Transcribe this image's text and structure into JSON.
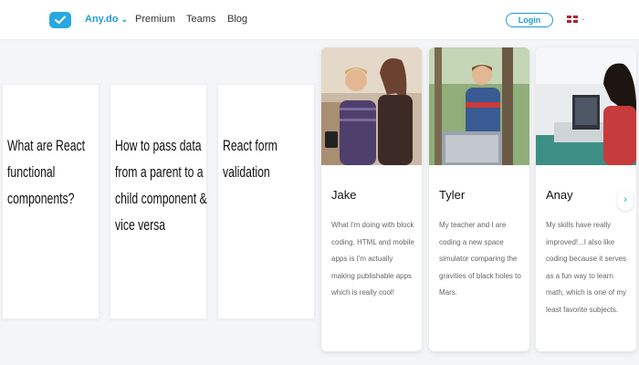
{
  "header": {
    "brand": "Any.do",
    "nav": [
      "Premium",
      "Teams",
      "Blog"
    ],
    "login_label": "Login",
    "icons": {
      "logo": "check-icon",
      "brand_chevron": "chevron-down-icon",
      "language_flag": "uk-flag-icon"
    }
  },
  "blog_posts": [
    {
      "title": "What are React functional components?"
    },
    {
      "title": "How to pass data from a parent to a child component & vice versa"
    },
    {
      "title": "React form validation"
    }
  ],
  "testimonials": [
    {
      "name": "Jake",
      "text": "What I'm doing with block coding, HTML and mobile apps is I'm actually making publishable apps which is really cool!"
    },
    {
      "name": "Tyler",
      "text": "My teacher and I are coding a new space simulator comparing the gravities of black holes to Mars."
    },
    {
      "name": "Anay",
      "text": "My skills have really improved!...I also like coding because it serves as a fun way to learn math, which is one of my least favorite subjects."
    }
  ],
  "carousel": {
    "next_icon": "chevron-right-icon"
  },
  "colors": {
    "brand": "#1f9ad8",
    "logo": "#29a8e0"
  }
}
